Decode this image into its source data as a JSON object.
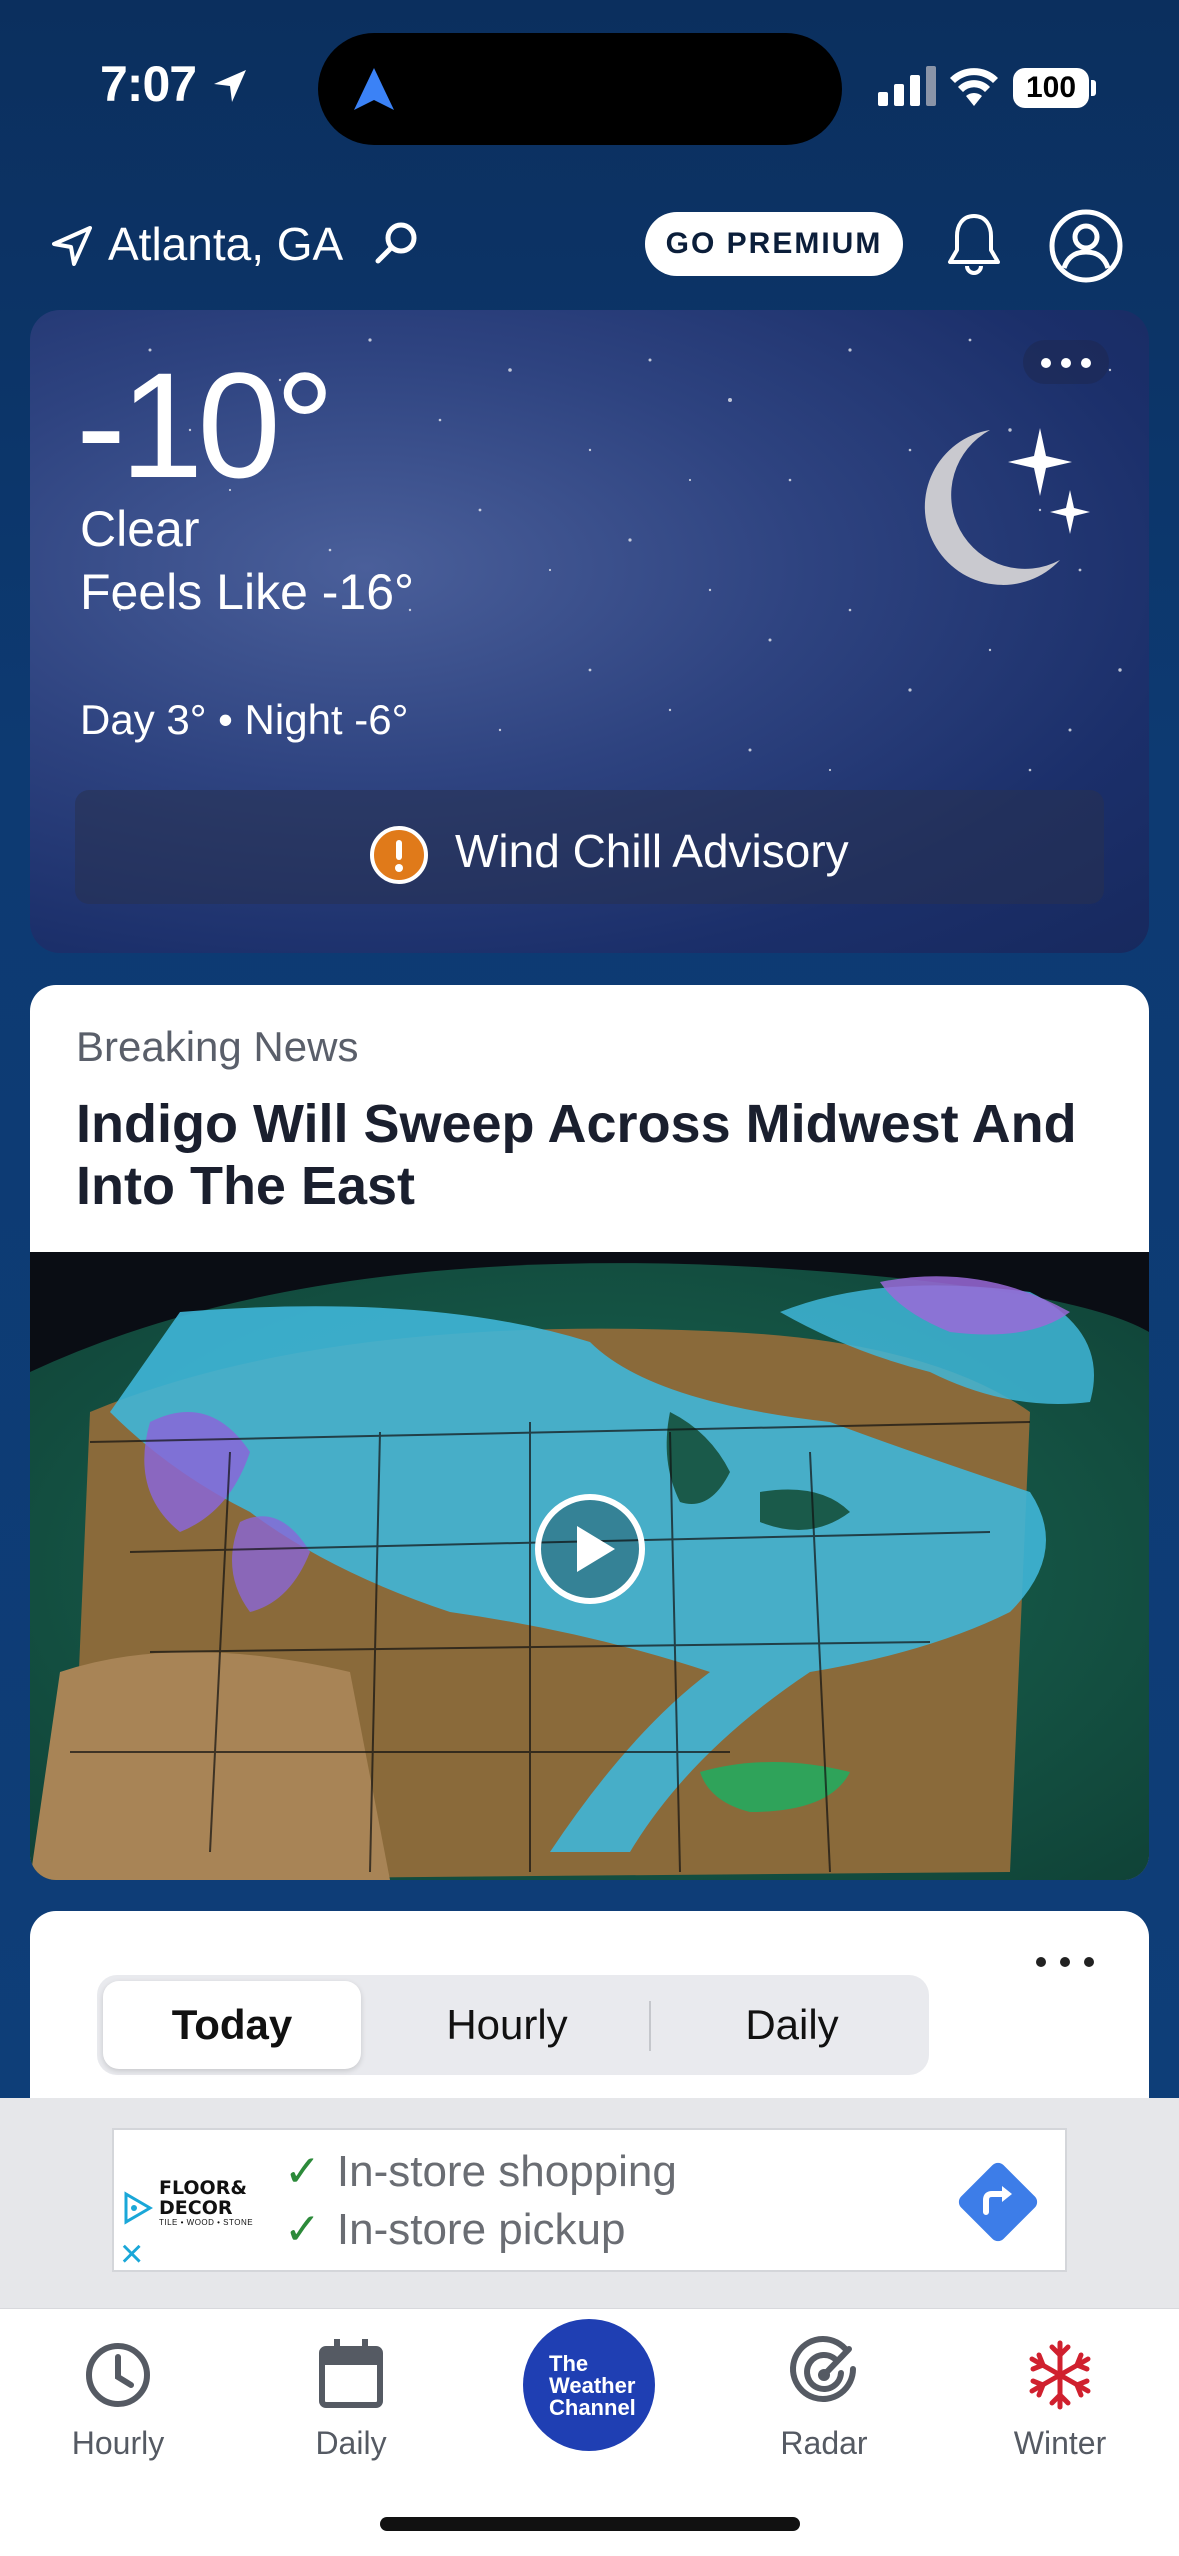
{
  "status_bar": {
    "time": "7:07",
    "battery": "100"
  },
  "header": {
    "location": "Atlanta, GA",
    "premium_label": "GO PREMIUM"
  },
  "current": {
    "temperature": "-10°",
    "condition": "Clear",
    "feels_like": "Feels Like -16°",
    "day_night": "Day 3° • Night -6°",
    "advisory": "Wind Chill Advisory",
    "icon": "moon-stars-icon"
  },
  "news": {
    "label": "Breaking News",
    "headline": "Indigo Will Sweep Across Midwest And Into The East"
  },
  "forecast": {
    "tabs": [
      {
        "label": "Today",
        "active": true
      },
      {
        "label": "Hourly",
        "active": false
      },
      {
        "label": "Daily",
        "active": false
      }
    ]
  },
  "ad": {
    "brand_line1": "FLOOR&",
    "brand_line2": "DECOR",
    "brand_sub": "TILE • WOOD • STONE",
    "line1": "In-store shopping",
    "line2": "In-store pickup"
  },
  "tab_bar": {
    "hourly": "Hourly",
    "daily": "Daily",
    "center_logo_line1": "The",
    "center_logo_line2": "Weather",
    "center_logo_line3": "Channel",
    "radar": "Radar",
    "winter": "Winter"
  },
  "colors": {
    "background": "#0d3a72",
    "advisory_orange": "#e07a1a",
    "twc_blue": "#1f3fb3",
    "winter_red": "#d0202e",
    "ad_direction_blue": "#3d7de8"
  }
}
